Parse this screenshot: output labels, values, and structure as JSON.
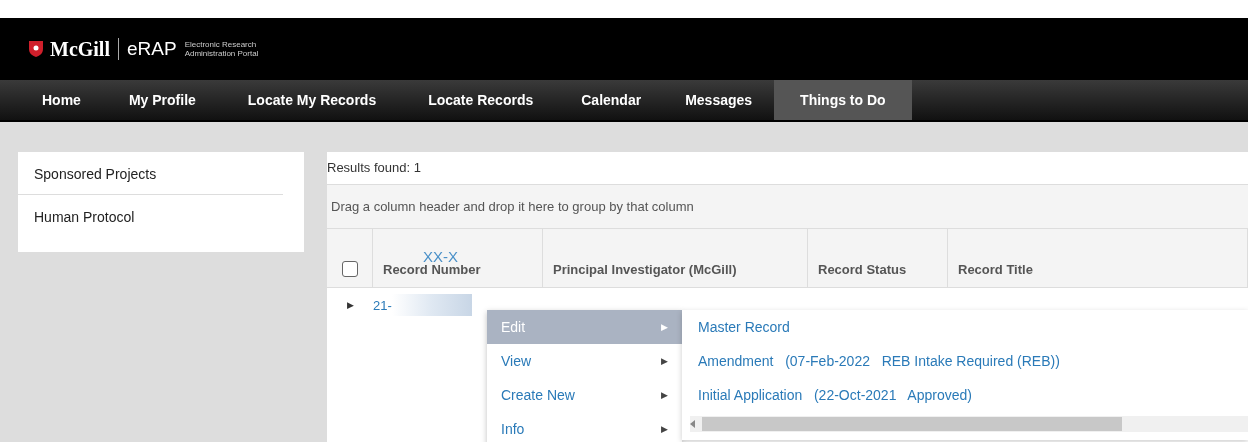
{
  "header": {
    "logo": "McGill",
    "product": "eRAP",
    "tagline_line1": "Electronic Research",
    "tagline_line2": "Administration Portal"
  },
  "nav": [
    {
      "label": "Home",
      "selected": false
    },
    {
      "label": "My Profile",
      "selected": false
    },
    {
      "label": "Locate My Records",
      "selected": false
    },
    {
      "label": "Locate Records",
      "selected": false
    },
    {
      "label": "Calendar",
      "selected": false
    },
    {
      "label": "Messages",
      "selected": false
    },
    {
      "label": "Things to Do",
      "selected": true
    }
  ],
  "sidebar": {
    "items": [
      "Sponsored Projects",
      "Human Protocol"
    ]
  },
  "results": {
    "count_label": "Results found: 1",
    "group_hint": "Drag a column header and drop it here to group by that column",
    "columns": [
      "Record Number",
      "Principal Investigator (McGill)",
      "Record Status",
      "Record Title"
    ],
    "header_overlay": "XX-X",
    "select_all_checked": false,
    "rows": [
      {
        "expander": "▶",
        "record_number": "21-"
      }
    ]
  },
  "context_menu": {
    "items": [
      {
        "label": "Edit",
        "arrow": "▶",
        "selected": true
      },
      {
        "label": "View",
        "arrow": "▶",
        "selected": false
      },
      {
        "label": "Create New",
        "arrow": "▶",
        "selected": false
      },
      {
        "label": "Info",
        "arrow": "▶",
        "selected": false
      }
    ]
  },
  "submenu": {
    "items": [
      {
        "label": "Master Record"
      },
      {
        "label": "Amendment",
        "detail": "(07-Feb-2022   REB Intake Required (REB))"
      },
      {
        "label": "Initial Application",
        "detail": "(22-Oct-2021   Approved)"
      }
    ]
  }
}
